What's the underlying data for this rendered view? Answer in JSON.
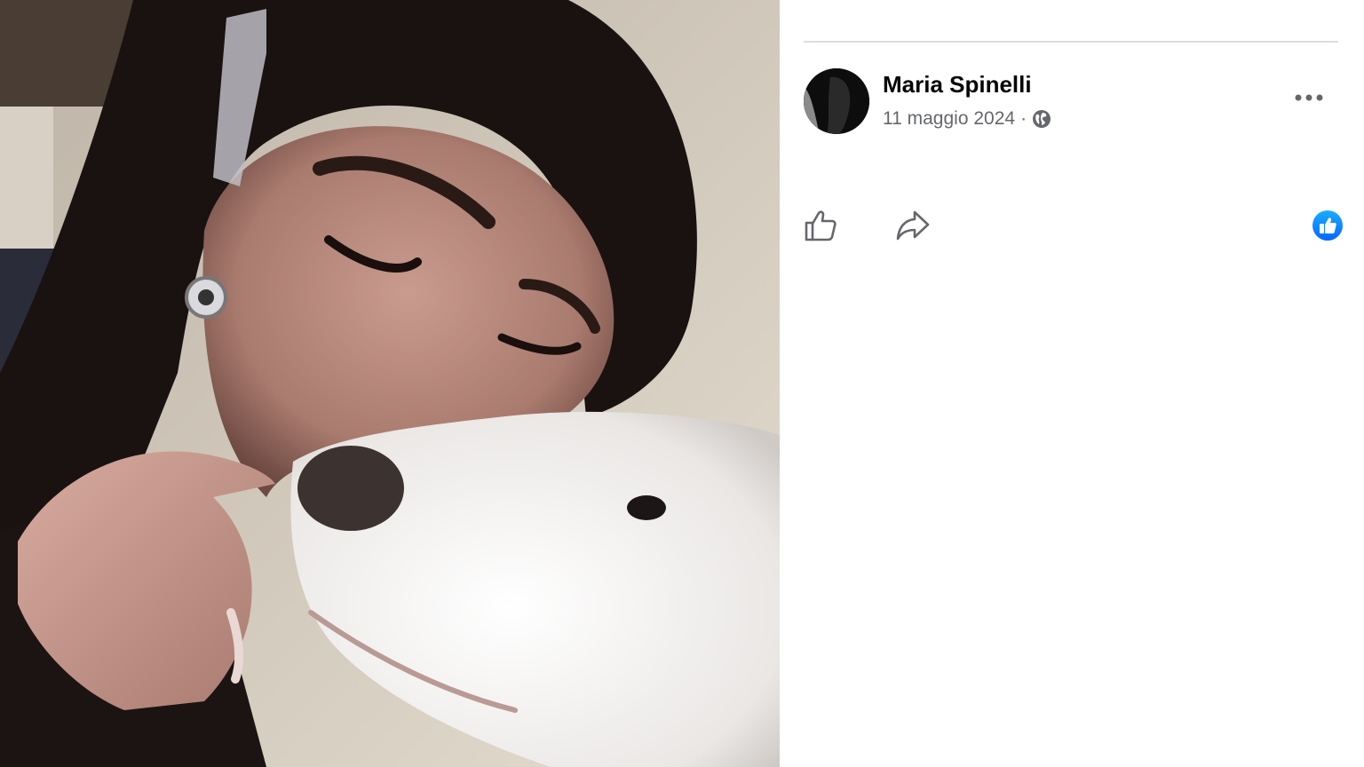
{
  "post": {
    "author_name": "Maria Spinelli",
    "date": "11 maggio 2024",
    "separator": "·",
    "privacy_icon": "globe-icon",
    "more_icon": "more-horizontal-icon"
  },
  "actions": {
    "like_icon": "thumbs-up-outline-icon",
    "share_icon": "share-arrow-icon",
    "reaction_icon": "like-reaction-icon"
  },
  "colors": {
    "name_text": "#050505",
    "secondary_text": "#65676b",
    "divider": "#dadde1",
    "reaction_blue": "#0866ff"
  }
}
